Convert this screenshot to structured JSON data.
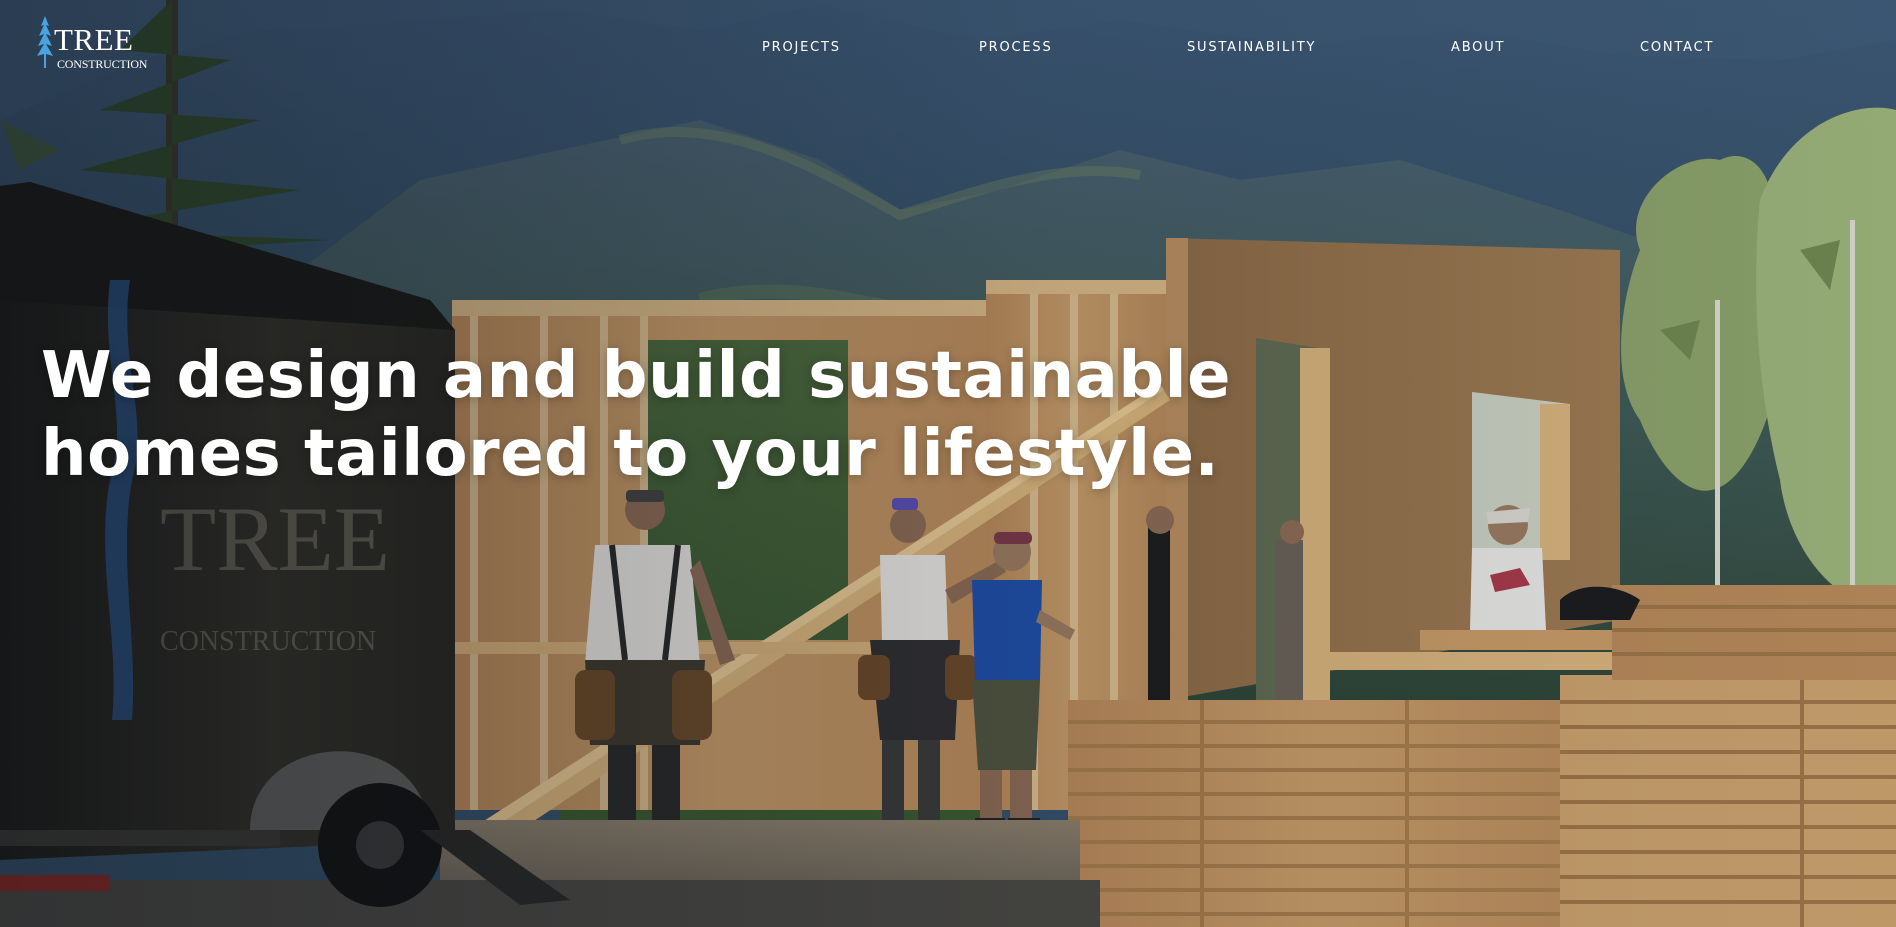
{
  "brand": {
    "name": "TREE",
    "subtitle": "CONSTRUCTION",
    "trailer_name": "TREE",
    "trailer_subtitle": "CONSTRUCTION"
  },
  "nav": {
    "items": [
      {
        "label": "PROJECTS"
      },
      {
        "label": "PROCESS"
      },
      {
        "label": "SUSTAINABILITY"
      },
      {
        "label": "ABOUT"
      },
      {
        "label": "CONTACT"
      }
    ]
  },
  "hero": {
    "headline_line1": "We design and build sustainable",
    "headline_line2": "homes tailored to your lifestyle."
  },
  "colors": {
    "text": "#ffffff",
    "logo_tree": "#4aa3e0",
    "plywood": "#c89f6c",
    "lumber": "#d7b27c",
    "mountain": "#2f4a62",
    "trailer": "#2b2a24"
  },
  "icons": {
    "logo_mark": "tree-icon"
  }
}
